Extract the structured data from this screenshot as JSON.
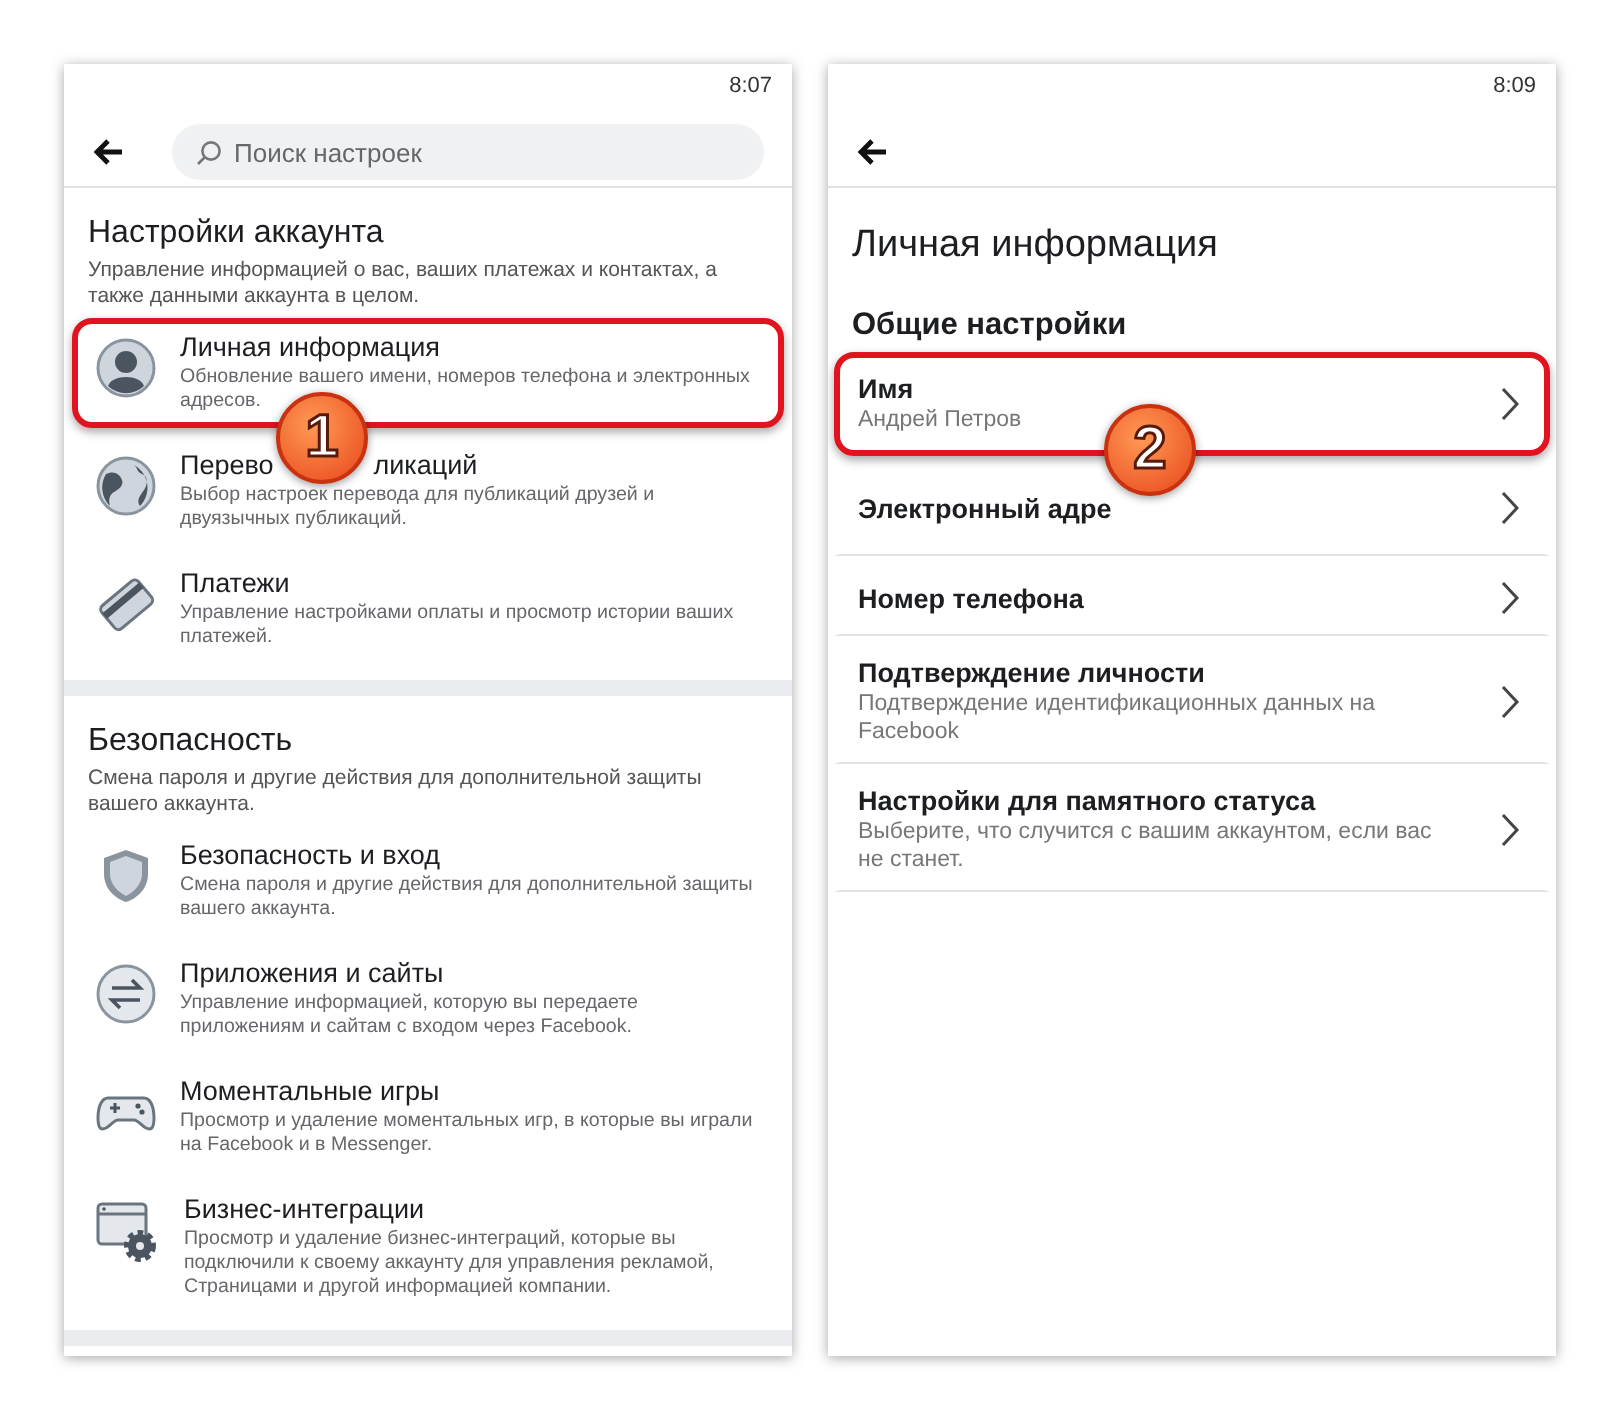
{
  "screens": [
    {
      "kind": "settings",
      "time": "8:07",
      "search": {
        "placeholder": "Поиск настроек"
      },
      "sections": [
        {
          "title": "Настройки аккаунта",
          "description": "Управление информацией о вас, ваших платежах и контактах, а также данными аккаунта в целом.",
          "items": [
            {
              "title": "Личная информация",
              "description": "Обновление вашего имени, номеров телефона и электронных адресов.",
              "highlighted": true,
              "badge": "1"
            },
            {
              "title_parts": [
                "Перево",
                "ликаций"
              ],
              "description": "Выбор настроек перевода для публикаций друзей и двуязычных публикаций.",
              "highlighted": false
            },
            {
              "title": "Платежи",
              "description": "Управление настройками оплаты и просмотр истории ваших платежей.",
              "highlighted": false
            }
          ]
        },
        {
          "title": "Безопасность",
          "description": "Смена пароля и другие действия для дополнительной защиты вашего аккаунта.",
          "items": [
            {
              "title": "Безопасность и вход",
              "description": "Смена пароля и другие действия для дополнительной защиты вашего аккаунта.",
              "highlighted": false
            },
            {
              "title": "Приложения и сайты",
              "description": "Управление информацией, которую вы передаете приложениям и сайтам с входом через Facebook.",
              "highlighted": false
            },
            {
              "title": "Моментальные игры",
              "description": "Просмотр и удаление моментальных игр, в которые вы играли на Facebook и в Messenger.",
              "highlighted": false
            },
            {
              "title": "Бизнес-интеграции",
              "description": "Просмотр и удаление бизнес-интеграций, которые вы подключили к своему аккаунту для управления рекламой, Страницами и другой информацией компании.",
              "highlighted": false
            }
          ]
        }
      ]
    },
    {
      "kind": "personal",
      "time": "8:09",
      "title": "Личная информация",
      "section": "Общие настройки",
      "rows": [
        {
          "title": "Имя",
          "value": "Андрей Петров",
          "highlighted": true,
          "badge": "2"
        },
        {
          "title": "Электронный адре",
          "highlighted": false
        },
        {
          "title": "Номер телефона",
          "highlighted": false
        },
        {
          "title": "Подтверждение личности",
          "value": "Подтверждение идентификационных данных на Facebook",
          "highlighted": false
        },
        {
          "title": "Настройки для памятного статуса",
          "value": "Выберите, что случится с вашим аккаунтом, если вас не станет.",
          "highlighted": false
        }
      ]
    }
  ]
}
